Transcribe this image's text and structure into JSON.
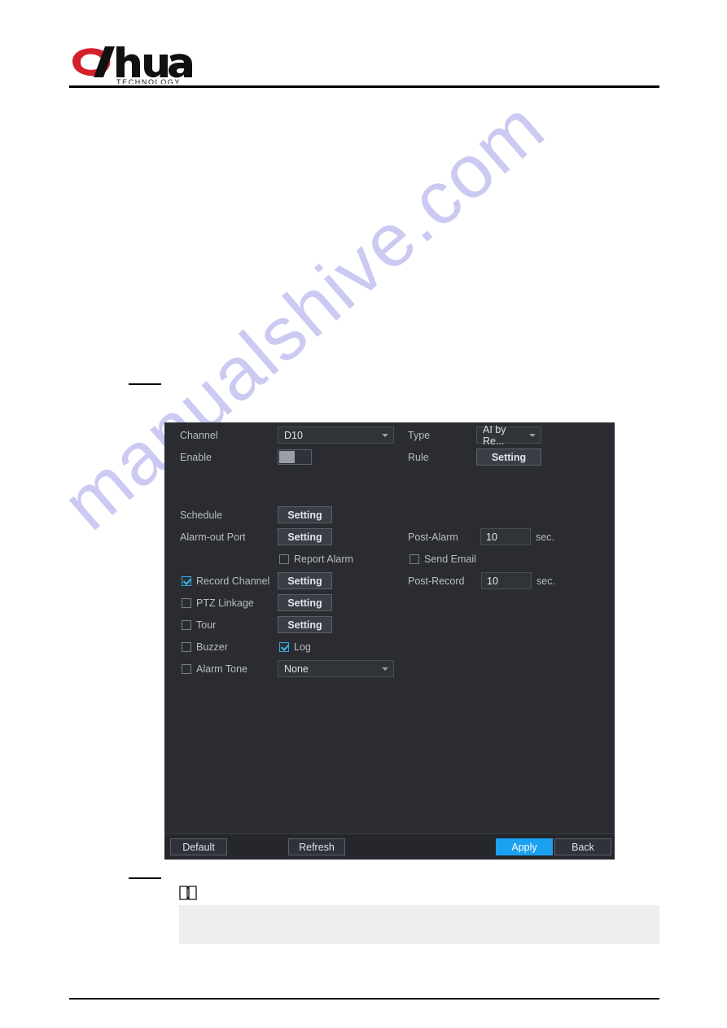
{
  "document": {
    "brand": "alhua",
    "brand_sub": "TECHNOLOGY"
  },
  "watermark": {
    "text": "manualshive.com",
    "color": "#b9b9ee"
  },
  "dialog": {
    "fields": {
      "channel_label": "Channel",
      "channel_value": "D10",
      "type_label": "Type",
      "type_value": "AI by Re...",
      "enable_label": "Enable",
      "enable_state": "off",
      "rule_label": "Rule",
      "rule_button": "Setting",
      "schedule_label": "Schedule",
      "schedule_button": "Setting",
      "alarm_out_label": "Alarm-out Port",
      "alarm_out_button": "Setting",
      "post_alarm_label": "Post-Alarm",
      "post_alarm_value": "10",
      "post_alarm_unit": "sec.",
      "report_alarm_label": "Report Alarm",
      "report_alarm_checked": false,
      "send_email_label": "Send Email",
      "send_email_checked": false,
      "record_channel_label": "Record Channel",
      "record_channel_checked": true,
      "record_channel_button": "Setting",
      "post_record_label": "Post-Record",
      "post_record_value": "10",
      "post_record_unit": "sec.",
      "ptz_linkage_label": "PTZ Linkage",
      "ptz_linkage_checked": false,
      "ptz_linkage_button": "Setting",
      "tour_label": "Tour",
      "tour_checked": false,
      "tour_button": "Setting",
      "buzzer_label": "Buzzer",
      "buzzer_checked": false,
      "log_label": "Log",
      "log_checked": true,
      "alarm_tone_label": "Alarm Tone",
      "alarm_tone_checked": false,
      "alarm_tone_value": "None"
    },
    "buttons": {
      "default": "Default",
      "refresh": "Refresh",
      "apply": "Apply",
      "back": "Back",
      "apply_color": "#1ca0f0"
    }
  },
  "note": {
    "icon": "book-note-icon",
    "body": ""
  }
}
